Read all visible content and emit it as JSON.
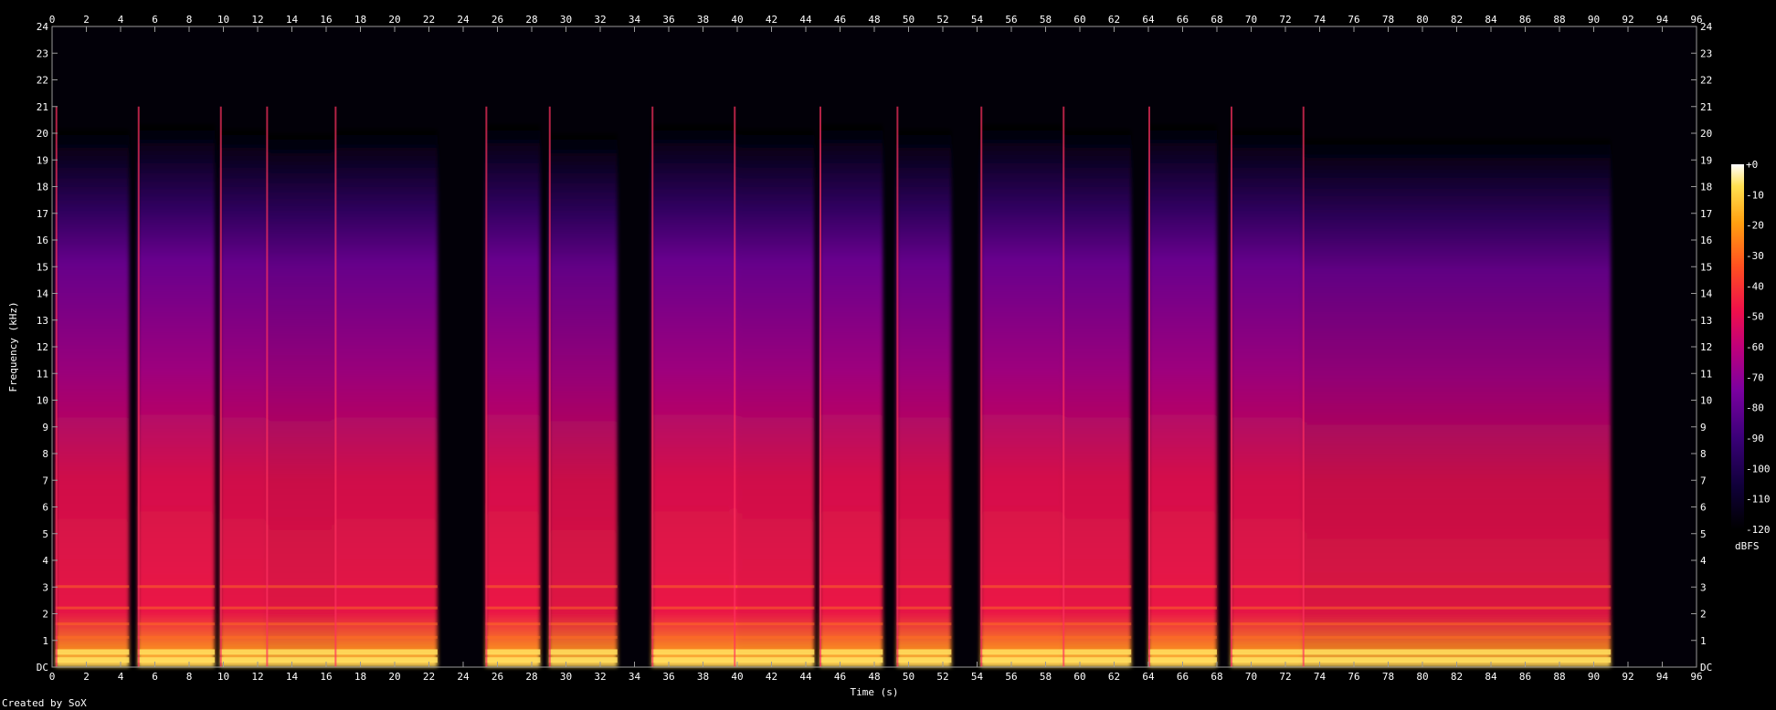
{
  "chart_data": {
    "type": "heatmap",
    "xlabel": "Time (s)",
    "ylabel": "Frequency (kHz)",
    "xlim": [
      0,
      96
    ],
    "ylim": [
      0,
      24
    ],
    "x_ticks": [
      "0",
      "2",
      "4",
      "6",
      "8",
      "10",
      "12",
      "14",
      "16",
      "18",
      "20",
      "22",
      "24",
      "26",
      "28",
      "30",
      "32",
      "34",
      "36",
      "38",
      "40",
      "42",
      "44",
      "46",
      "48",
      "50",
      "52",
      "54",
      "56",
      "58",
      "60",
      "62",
      "64",
      "66",
      "68",
      "70",
      "72",
      "74",
      "76",
      "78",
      "80",
      "82",
      "84",
      "86",
      "88",
      "90",
      "92",
      "94",
      "96"
    ],
    "y_ticks": [
      "DC",
      "1",
      "2",
      "3",
      "4",
      "5",
      "6",
      "7",
      "8",
      "9",
      "10",
      "11",
      "12",
      "13",
      "14",
      "15",
      "16",
      "17",
      "18",
      "19",
      "20",
      "21",
      "22",
      "23",
      "24"
    ],
    "colorbar": {
      "label": "dBFS",
      "ticks": [
        "+0",
        "-10",
        "-20",
        "-30",
        "-40",
        "-50",
        "-60",
        "-70",
        "-80",
        "-90",
        "-100",
        "-110",
        "-120"
      ],
      "range": [
        -120,
        0
      ],
      "colors": [
        "#000000",
        "#10003a",
        "#3a0078",
        "#7a00a0",
        "#c0007a",
        "#f0104a",
        "#ff5020",
        "#ffa010",
        "#ffe050",
        "#ffffff"
      ]
    },
    "segments": [
      {
        "start": 0.2,
        "end": 4.5,
        "energy": 0.9
      },
      {
        "start": 5.0,
        "end": 9.5,
        "energy": 0.95
      },
      {
        "start": 9.8,
        "end": 12.5,
        "energy": 0.9
      },
      {
        "start": 12.5,
        "end": 16.5,
        "energy": 0.85
      },
      {
        "start": 16.5,
        "end": 22.5,
        "energy": 0.9
      },
      {
        "start": 25.3,
        "end": 28.5,
        "energy": 0.95
      },
      {
        "start": 29.0,
        "end": 33.0,
        "energy": 0.85
      },
      {
        "start": 35.0,
        "end": 40.0,
        "energy": 0.95
      },
      {
        "start": 39.8,
        "end": 44.5,
        "energy": 0.9
      },
      {
        "start": 44.8,
        "end": 48.5,
        "energy": 0.95
      },
      {
        "start": 49.3,
        "end": 52.5,
        "energy": 0.9
      },
      {
        "start": 54.2,
        "end": 59.0,
        "energy": 0.95
      },
      {
        "start": 59.0,
        "end": 63.0,
        "energy": 0.9
      },
      {
        "start": 64.0,
        "end": 68.0,
        "energy": 0.95
      },
      {
        "start": 68.8,
        "end": 73.0,
        "energy": 0.9
      },
      {
        "start": 73.0,
        "end": 91.0,
        "energy": 0.8
      }
    ],
    "grid": false
  },
  "footer": {
    "credit": "Created by SoX"
  }
}
